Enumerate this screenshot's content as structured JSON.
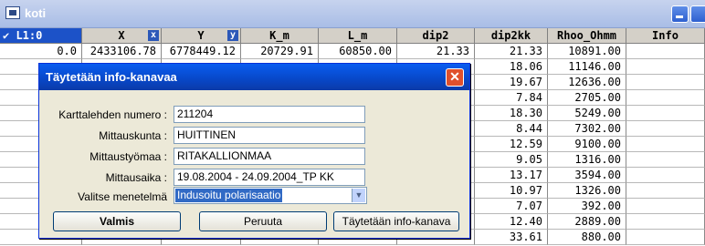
{
  "window": {
    "title": "koti"
  },
  "grid": {
    "first_header": "✔ L1:0",
    "columns": [
      "X",
      "Y",
      "K_m",
      "L_m",
      "dip2",
      "dip2kk",
      "Rhoo_Ohmm",
      "Info"
    ],
    "column_marks": [
      "x",
      "y"
    ],
    "rows": [
      [
        "0.0",
        "2433106.78",
        "6778449.12",
        "20729.91",
        "60850.00",
        "21.33",
        "21.33",
        "10891.00",
        ""
      ],
      [
        "",
        "",
        "",
        "",
        "",
        "",
        "18.06",
        "11146.00",
        ""
      ],
      [
        "",
        "",
        "",
        "",
        "",
        "",
        "19.67",
        "12636.00",
        ""
      ],
      [
        "",
        "",
        "",
        "",
        "",
        "",
        "7.84",
        "2705.00",
        ""
      ],
      [
        "",
        "",
        "",
        "",
        "",
        "",
        "18.30",
        "5249.00",
        ""
      ],
      [
        "",
        "",
        "",
        "",
        "",
        "",
        "8.44",
        "7302.00",
        ""
      ],
      [
        "",
        "",
        "",
        "",
        "",
        "",
        "12.59",
        "9100.00",
        ""
      ],
      [
        "",
        "",
        "",
        "",
        "",
        "",
        "9.05",
        "1316.00",
        ""
      ],
      [
        "",
        "",
        "",
        "",
        "",
        "",
        "13.17",
        "3594.00",
        ""
      ],
      [
        "",
        "",
        "",
        "",
        "",
        "",
        "10.97",
        "1326.00",
        ""
      ],
      [
        "",
        "",
        "",
        "",
        "",
        "",
        "7.07",
        "392.00",
        ""
      ],
      [
        "",
        "",
        "",
        "",
        "",
        "",
        "12.40",
        "2889.00",
        ""
      ],
      [
        "",
        "",
        "",
        "",
        "",
        "",
        "33.61",
        "880.00",
        ""
      ]
    ]
  },
  "dialog": {
    "title": "Täytetään info-kanavaa",
    "fields": [
      {
        "label": "Karttalehden numero :",
        "value": "211204"
      },
      {
        "label": "Mittauskunta :",
        "value": "HUITTINEN"
      },
      {
        "label": "Mittaustyömaa :",
        "value": "RITAKALLIONMAA"
      },
      {
        "label": "Mittausaika :",
        "value": "19.08.2004 - 24.09.2004_TP KK"
      }
    ],
    "method": {
      "label": "Valitse menetelmä",
      "value": "Indusoitu polarisaatio"
    },
    "buttons": {
      "ok": "Valmis",
      "cancel": "Peruuta",
      "fill": "Täytetään info-kanava"
    }
  },
  "colors": {
    "dialog_title": "#0a5df0",
    "selection": "#316ac5",
    "close_button": "#e0502c"
  }
}
